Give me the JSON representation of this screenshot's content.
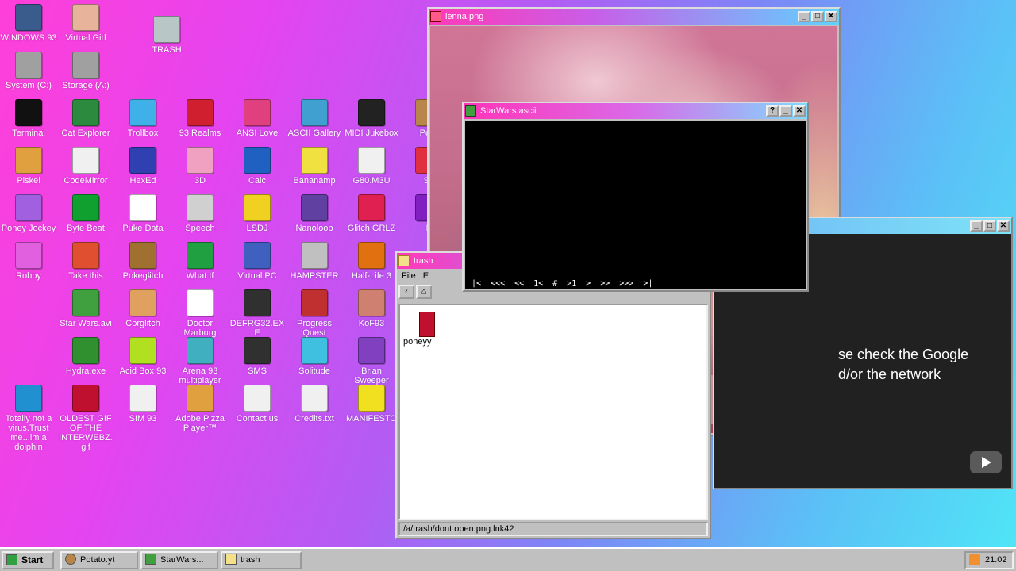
{
  "desktop": {
    "icons": [
      {
        "label": "WINDOWS 93",
        "icon": "windows93-icon",
        "color": "#3a5c8c"
      },
      {
        "label": "Virtual Girl",
        "icon": "virtual-girl-icon",
        "color": "#e7b39a"
      },
      {
        "label": "TRASH",
        "icon": "trash-icon",
        "color": "#b9c6c6"
      },
      {
        "label": "System (C:)",
        "icon": "drive-c-icon",
        "color": "#a0a0a0"
      },
      {
        "label": "Storage (A:)",
        "icon": "floppy-drive-icon",
        "color": "#a0a0a0"
      },
      {
        "label": "Terminal",
        "icon": "terminal-icon",
        "color": "#111111"
      },
      {
        "label": "Cat Explorer",
        "icon": "cat-explorer-icon",
        "color": "#2b8a3e"
      },
      {
        "label": "Trollbox",
        "icon": "trollbox-icon",
        "color": "#3fb0e8"
      },
      {
        "label": "93 Realms",
        "icon": "realms-icon",
        "color": "#d02030"
      },
      {
        "label": "ANSI Love",
        "icon": "ansi-love-icon",
        "color": "#e04080"
      },
      {
        "label": "ASCII Gallery",
        "icon": "ascii-gallery-icon",
        "color": "#40a0d0"
      },
      {
        "label": "MIDI Jukebox",
        "icon": "midi-jukebox-icon",
        "color": "#222222"
      },
      {
        "label": "Pota",
        "icon": "potato-icon",
        "color": "#b8864a"
      },
      {
        "label": "Piskel",
        "icon": "piskel-icon",
        "color": "#e0a040"
      },
      {
        "label": "CodeMirror",
        "icon": "codemirror-icon",
        "color": "#f0f0f0"
      },
      {
        "label": "HexEd",
        "icon": "hexed-icon",
        "color": "#3040b0"
      },
      {
        "label": "3D",
        "icon": "teapot-3d-icon",
        "color": "#f0a0c0"
      },
      {
        "label": "Calc",
        "icon": "calc-icon",
        "color": "#2060c0"
      },
      {
        "label": "Bananamp",
        "icon": "bananamp-icon",
        "color": "#f0e040"
      },
      {
        "label": "G80.M3U",
        "icon": "playlist-icon",
        "color": "#f0f0f0"
      },
      {
        "label": "Sc",
        "icon": "screensaver-icon",
        "color": "#e03040"
      },
      {
        "label": "Poney Jockey",
        "icon": "poney-jockey-icon",
        "color": "#a060e0"
      },
      {
        "label": "Byte Beat",
        "icon": "byte-beat-icon",
        "color": "#10a030"
      },
      {
        "label": "Puke Data",
        "icon": "puke-data-icon",
        "color": "#ffffff"
      },
      {
        "label": "Speech",
        "icon": "speech-icon",
        "color": "#d0d0d0"
      },
      {
        "label": "LSDJ",
        "icon": "lsdj-icon",
        "color": "#f0d020"
      },
      {
        "label": "Nanoloop",
        "icon": "nanoloop-icon",
        "color": "#6040a0"
      },
      {
        "label": "Glitch GRLZ",
        "icon": "glitch-grlz-icon",
        "color": "#e02050"
      },
      {
        "label": "F",
        "icon": "flower-icon",
        "color": "#8020c0"
      },
      {
        "label": "Robby",
        "icon": "robby-icon",
        "color": "#e060e0"
      },
      {
        "label": "Take this",
        "icon": "take-this-icon",
        "color": "#e05030"
      },
      {
        "label": "Pokegl̴itch",
        "icon": "pokeglitch-icon",
        "color": "#a07030"
      },
      {
        "label": "What If",
        "icon": "what-if-icon",
        "color": "#20a040"
      },
      {
        "label": "Virtual PC",
        "icon": "virtual-pc-icon",
        "color": "#4060c0"
      },
      {
        "label": "HAMPSTER",
        "icon": "hampster-icon",
        "color": "#c0c0c0"
      },
      {
        "label": "Half-Life 3",
        "icon": "half-life-icon",
        "color": "#e07010"
      },
      {
        "label": "Star Wars.avi",
        "icon": "yoda-icon",
        "color": "#40a040"
      },
      {
        "label": "Corglitch",
        "icon": "corgi-icon",
        "color": "#e0a060"
      },
      {
        "label": "Doctor Marburg",
        "icon": "doctor-icon",
        "color": "#ffffff"
      },
      {
        "label": "DEFRG32.EXE",
        "icon": "defrag-icon",
        "color": "#303030"
      },
      {
        "label": "Progress Quest",
        "icon": "progress-quest-icon",
        "color": "#c03030"
      },
      {
        "label": "KoF93",
        "icon": "kof-icon",
        "color": "#d08070"
      },
      {
        "label": "Hydra.exe",
        "icon": "hydra-icon",
        "color": "#309030"
      },
      {
        "label": "Acid Box 93",
        "icon": "acid-smiley-icon",
        "color": "#b0e020"
      },
      {
        "label": "Arena 93 multiplayer",
        "icon": "arena-cube-icon",
        "color": "#40b0c0"
      },
      {
        "label": "SMS",
        "icon": "sms-console-icon",
        "color": "#303030"
      },
      {
        "label": "Solitude",
        "icon": "solitude-icon",
        "color": "#40c0e0"
      },
      {
        "label": "Brian Sweeper",
        "icon": "mine-icon",
        "color": "#8040c0"
      },
      {
        "label": "Totally not a virus.Trust me...im a dolphin",
        "icon": "dolphin-icon",
        "color": "#2090d0"
      },
      {
        "label": "OLDEST GIF OF THE INTERWEBZ.gif",
        "icon": "gif-file-icon",
        "color": "#c01030"
      },
      {
        "label": "SIM 93",
        "icon": "sim93-icon",
        "color": "#f0f0f0"
      },
      {
        "label": "Adobe Pizza Player™",
        "icon": "pizza-icon",
        "color": "#e0a040"
      },
      {
        "label": "Contact us",
        "icon": "contact-icon",
        "color": "#f0f0f0"
      },
      {
        "label": "Credits.txt",
        "icon": "text-file-icon",
        "color": "#f0f0f0"
      },
      {
        "label": "MANIFESTO",
        "icon": "question-icon",
        "color": "#f0e020"
      }
    ]
  },
  "windows": {
    "lenna": {
      "title": "lenna.png"
    },
    "trash": {
      "title": "trash",
      "menu_file": "File",
      "menu_e": "E",
      "back_label": "‹",
      "file_name": "poneyy",
      "status": "/a/trash/dont open.png.lnk42"
    },
    "youtube": {
      "message_line1": "se check the Google",
      "message_line2": "d/or the network"
    },
    "starwars": {
      "title": "StarWars.ascii",
      "help_btn": "?",
      "controls": [
        "|<",
        "<<<",
        "<<",
        "1<",
        "#",
        ">1",
        ">",
        ">>",
        ">>>",
        ">|"
      ]
    }
  },
  "taskbar": {
    "start": "Start",
    "tasks": [
      "Potato.yt",
      "StarWars...",
      "trash"
    ],
    "clock": "21:02"
  },
  "colors": {
    "accent_pink": "#ff3ab6",
    "accent_cyan": "#5fd3ff",
    "window_gray": "#c0c0c0"
  }
}
